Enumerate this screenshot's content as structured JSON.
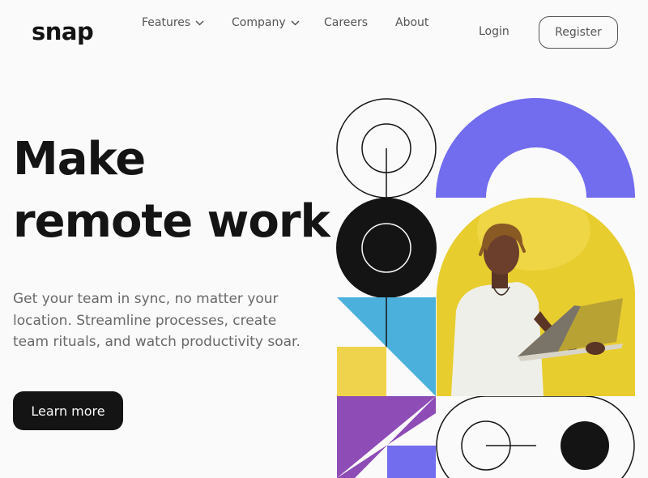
{
  "header": {
    "logo": "snap",
    "nav": [
      {
        "label": "Features",
        "has_dropdown": true
      },
      {
        "label": "Company",
        "has_dropdown": true
      },
      {
        "label": "Careers",
        "has_dropdown": false
      },
      {
        "label": "About",
        "has_dropdown": false
      }
    ],
    "login_label": "Login",
    "register_label": "Register"
  },
  "hero": {
    "title_line1": "Make",
    "title_line2": "remote work",
    "description": "Get your team in sync, no matter your location. Streamline processes, create team rituals, and watch productivity soar.",
    "cta_label": "Learn more"
  },
  "colors": {
    "text_dark": "#141414",
    "text_gray": "#686868",
    "background": "#fafafa",
    "accent_purple": "#726cee",
    "accent_blue": "#4bb1dc",
    "accent_yellow": "#f0d34c",
    "accent_violet": "#8e4cb6"
  },
  "icons": {
    "dropdown": "chevron-down-icon"
  }
}
